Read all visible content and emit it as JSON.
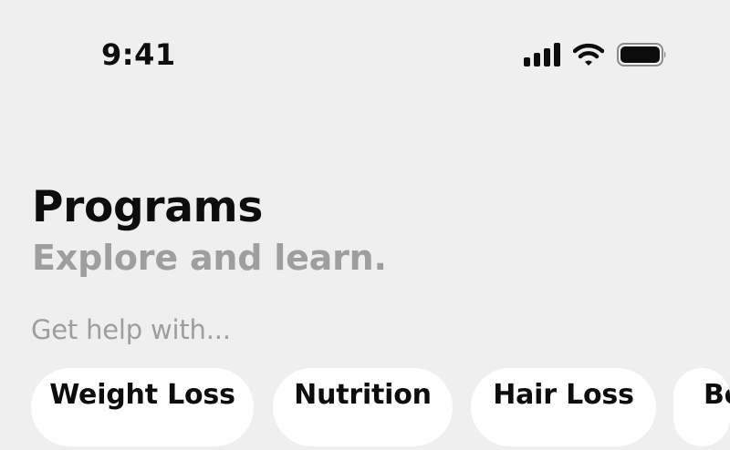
{
  "status_bar": {
    "time": "9:41",
    "icons": [
      "cellular-signal-icon",
      "wifi-icon",
      "battery-icon"
    ]
  },
  "header": {
    "title": "Programs",
    "subtitle": "Explore and learn."
  },
  "help_section": {
    "label": "Get help with...",
    "chips": [
      {
        "label": "Weight Loss"
      },
      {
        "label": "Nutrition"
      },
      {
        "label": "Hair Loss"
      },
      {
        "label": "Be"
      }
    ]
  },
  "colors": {
    "background": "#efefef",
    "primary_text": "#0d0d0d",
    "secondary_text": "#9e9e9e",
    "chip_background": "#ffffff"
  }
}
